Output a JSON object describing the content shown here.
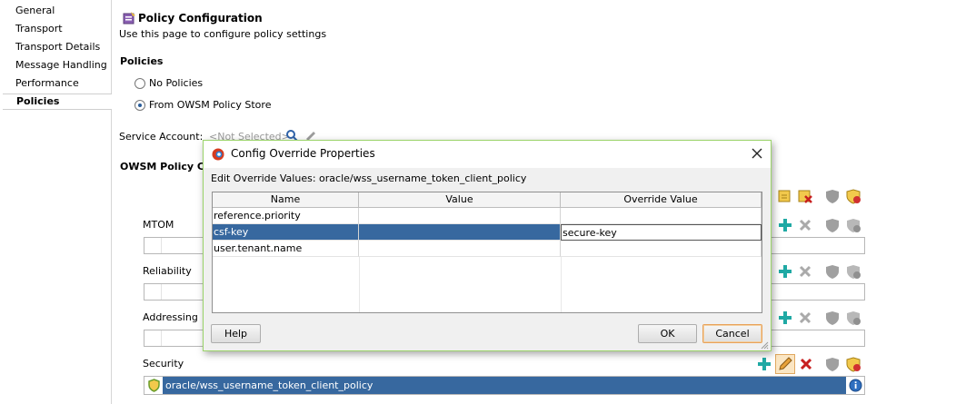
{
  "nav": {
    "items": [
      "General",
      "Transport",
      "Transport Details",
      "Message Handling",
      "Performance",
      "Policies"
    ],
    "active": "Policies"
  },
  "main": {
    "title": "Policy Configuration",
    "subtitle": "Use this page to configure policy settings",
    "policies_heading": "Policies",
    "radio_no_policies": "No Policies",
    "radio_owsm": "From OWSM Policy Store",
    "service_account_label": "Service Account:",
    "service_account_value": "<Not Selected>",
    "owsm_heading": "OWSM Policy Co",
    "sections": [
      "MTOM",
      "Reliability",
      "Addressing",
      "Security"
    ],
    "security_policy": "oracle/wss_username_token_client_policy"
  },
  "dialog": {
    "title": "Config Override Properties",
    "caption": "Edit Override Values: oracle/wss_username_token_client_policy",
    "columns": [
      "Name",
      "Value",
      "Override Value"
    ],
    "rows": [
      {
        "name": "reference.priority",
        "value": "",
        "override": ""
      },
      {
        "name": "csf-key",
        "value": "",
        "override": "secure-key"
      },
      {
        "name": "user.tenant.name",
        "value": "",
        "override": ""
      }
    ],
    "selected_row": 1,
    "help_label": "Help",
    "ok_label": "OK",
    "cancel_label": "Cancel"
  },
  "colors": {
    "selection": "#37689f",
    "dialog_border": "#9bd46a",
    "add_icon": "#1fa9a4",
    "delete_icon": "#c71f1f"
  }
}
